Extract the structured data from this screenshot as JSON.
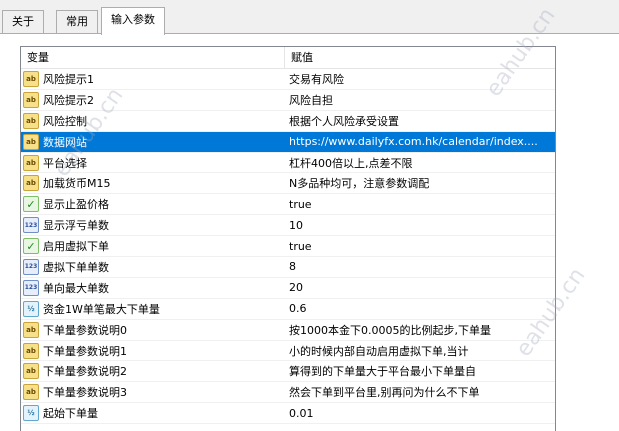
{
  "tabs": [
    {
      "label": "关于"
    },
    {
      "label": "常用"
    },
    {
      "label": "输入参数"
    }
  ],
  "table": {
    "col_variable": "变量",
    "col_value": "赋值",
    "rows": [
      {
        "type": "ab",
        "name": "风险提示1",
        "value": "交易有风险"
      },
      {
        "type": "ab",
        "name": "风险提示2",
        "value": "风险自担"
      },
      {
        "type": "ab",
        "name": "风险控制",
        "value": "根据个人风险承受设置"
      },
      {
        "type": "ab",
        "name": "数据网站",
        "value": "https://www.dailyfx.com.hk/calendar/index...."
      },
      {
        "type": "ab",
        "name": "平台选择",
        "value": "杠杆400倍以上,点差不限"
      },
      {
        "type": "ab",
        "name": "加载货币M15",
        "value": "N多品种均可，注意参数调配"
      },
      {
        "type": "bool",
        "name": "显示止盈价格",
        "value": "true"
      },
      {
        "type": "int",
        "name": "显示浮亏单数",
        "value": "10"
      },
      {
        "type": "bool",
        "name": "启用虚拟下单",
        "value": "true"
      },
      {
        "type": "int",
        "name": "虚拟下单单数",
        "value": "8"
      },
      {
        "type": "int",
        "name": "单向最大单数",
        "value": "20"
      },
      {
        "type": "dbl",
        "name": "资金1W单笔最大下单量",
        "value": "0.6"
      },
      {
        "type": "ab",
        "name": "下单量参数说明0",
        "value": "按1000本金下0.0005的比例起步,下单量"
      },
      {
        "type": "ab",
        "name": "下单量参数说明1",
        "value": "小的时候内部自动启用虚拟下单,当计"
      },
      {
        "type": "ab",
        "name": "下单量参数说明2",
        "value": "算得到的下单量大于平台最小下单量自"
      },
      {
        "type": "ab",
        "name": "下单量参数说明3",
        "value": "然会下单到平台里,别再问为什么不下单"
      },
      {
        "type": "dbl",
        "name": "起始下单量",
        "value": "0.01"
      }
    ],
    "selected_row_index": 3
  },
  "icons": {
    "ab": "string-type-icon",
    "bool": "bool-type-icon",
    "int": "integer-type-icon",
    "dbl": "double-type-icon"
  },
  "colors": {
    "selection": "#0078d7",
    "ab_icon": "#f6e08a",
    "bool_icon": "#7cbf68",
    "int_icon": "#6f8fc7",
    "dbl_icon": "#5fa8cf"
  }
}
